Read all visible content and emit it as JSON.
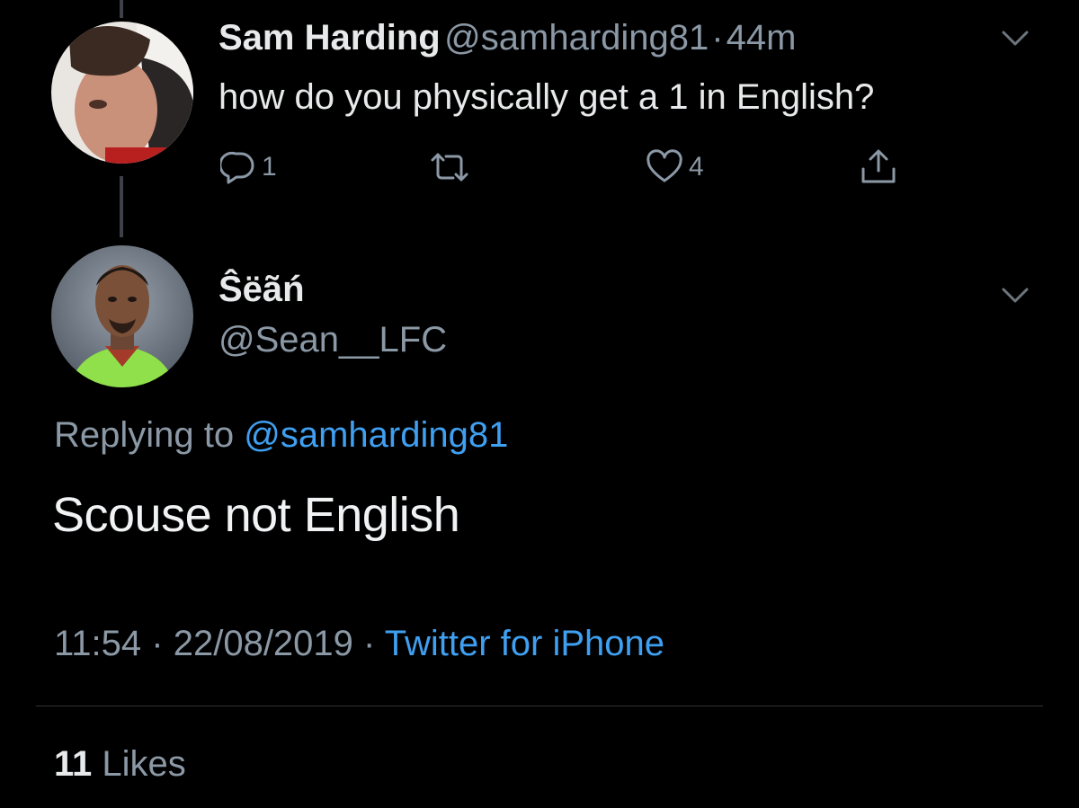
{
  "parent_tweet": {
    "author_name": "Sam Harding",
    "author_handle": "@samharding81",
    "separator": "·",
    "time_ago": "44m",
    "text": "how do you physically get a 1 in English?",
    "reply_count": "1",
    "like_count": "4",
    "icons": {
      "reply": "speech-bubble-icon",
      "retweet": "retweet-arrows-icon",
      "like": "heart-icon",
      "share": "share-upload-icon",
      "menu": "chevron-down-icon"
    }
  },
  "main_tweet": {
    "author_name": "Ŝëãń",
    "author_handle": "@Sean__LFC",
    "reply_prefix": "Replying to",
    "reply_mention": "@samharding81",
    "text": "Scouse not English",
    "time": "11:54",
    "date_separator": "·",
    "date": "22/08/2019",
    "source_separator": "·",
    "source": "Twitter for iPhone",
    "likes_count": "11",
    "likes_label": "Likes"
  },
  "colors": {
    "background": "#000000",
    "primary_text": "#e7e9ea",
    "secondary_text": "#8b98a5",
    "link": "#3f9ff0",
    "divider": "#2f3336"
  }
}
